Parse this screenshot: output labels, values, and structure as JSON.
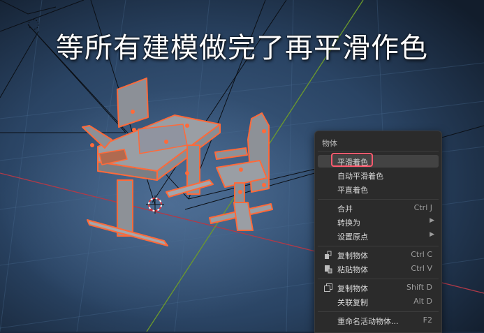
{
  "caption": "等所有建模做完了再平滑作色",
  "menu": {
    "title": "物体",
    "items": [
      {
        "label": "平滑着色",
        "shortcut": "",
        "submenu": false,
        "icon": "",
        "highlighted": true
      },
      {
        "label": "自动平滑着色",
        "shortcut": "",
        "submenu": false,
        "icon": ""
      },
      {
        "label": "平直着色",
        "shortcut": "",
        "submenu": false,
        "icon": ""
      },
      {
        "label": "合并",
        "shortcut": "Ctrl J",
        "submenu": false,
        "icon": ""
      },
      {
        "label": "转换为",
        "shortcut": "",
        "submenu": true,
        "icon": ""
      },
      {
        "label": "设置原点",
        "shortcut": "",
        "submenu": true,
        "icon": ""
      },
      {
        "label": "复制物体",
        "shortcut": "Ctrl C",
        "submenu": false,
        "icon": "copy-buffer-icon"
      },
      {
        "label": "粘贴物体",
        "shortcut": "Ctrl V",
        "submenu": false,
        "icon": "paste-buffer-icon"
      },
      {
        "label": "复制物体",
        "shortcut": "Shift D",
        "submenu": false,
        "icon": "duplicate-icon"
      },
      {
        "label": "关联复制",
        "shortcut": "Alt D",
        "submenu": false,
        "icon": ""
      },
      {
        "label": "重命名活动物体...",
        "shortcut": "F2",
        "submenu": false,
        "icon": ""
      }
    ]
  },
  "colors": {
    "selection_outline": "#ff6a3a",
    "highlight_box": "#ff5a6e",
    "menu_bg": "#2b2b2b"
  }
}
